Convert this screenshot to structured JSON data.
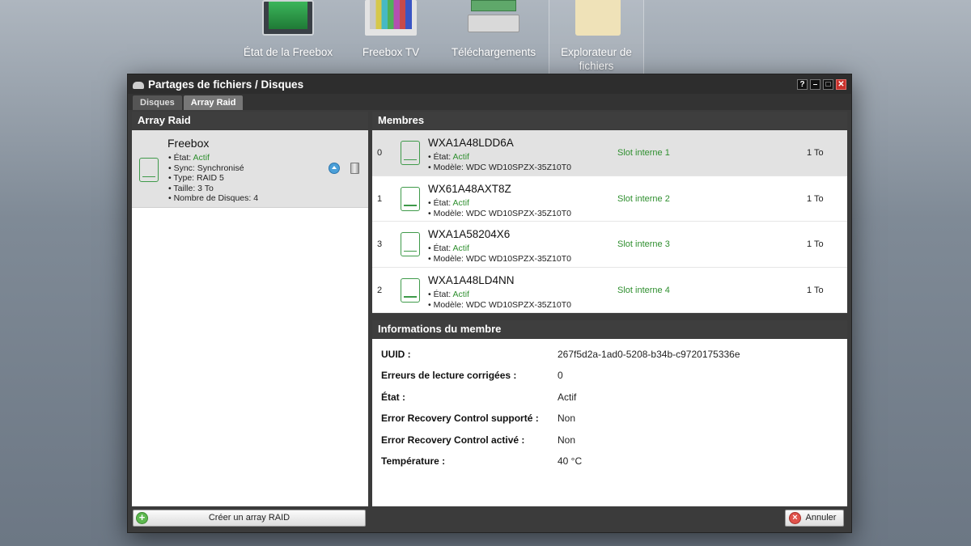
{
  "desktop": {
    "icons": [
      {
        "label": "État de la Freebox",
        "icon": "monitor-graph-icon"
      },
      {
        "label": "Freebox TV",
        "icon": "tv-icon"
      },
      {
        "label": "Téléchargements",
        "icon": "download-icon"
      },
      {
        "label": "Explorateur de fichiers",
        "icon": "folder-icon"
      }
    ]
  },
  "window": {
    "title": "Partages de fichiers / Disques",
    "buttons": {
      "help": "?",
      "minimize": "–",
      "maximize": "□",
      "close": "✕"
    },
    "tabs": [
      {
        "label": "Disques",
        "active": false
      },
      {
        "label": "Array Raid",
        "active": true
      }
    ]
  },
  "left_panel": {
    "title": "Array Raid",
    "array": {
      "name": "Freebox",
      "etat_label": "• État: ",
      "etat_value": "Actif",
      "sync": "• Sync: Synchronisé",
      "type": "• Type: RAID 5",
      "taille": "• Taille: 3 To",
      "nb_disques": "• Nombre de Disques: 4"
    },
    "create_button": "Créer un array RAID"
  },
  "members_panel": {
    "title": "Membres",
    "rows": [
      {
        "index": "0",
        "serial": "WXA1A48LDD6A",
        "etat_label": "• État: ",
        "etat_value": "Actif",
        "modele": "• Modèle: WDC WD10SPZX-35Z10T0",
        "slot": "Slot interne 1",
        "size": "1 To",
        "selected": true
      },
      {
        "index": "1",
        "serial": "WX61A48AXT8Z",
        "etat_label": "• État: ",
        "etat_value": "Actif",
        "modele": "• Modèle: WDC WD10SPZX-35Z10T0",
        "slot": "Slot interne 2",
        "size": "1 To",
        "selected": false
      },
      {
        "index": "3",
        "serial": "WXA1A58204X6",
        "etat_label": "• État: ",
        "etat_value": "Actif",
        "modele": "• Modèle: WDC WD10SPZX-35Z10T0",
        "slot": "Slot interne 3",
        "size": "1 To",
        "selected": false
      },
      {
        "index": "2",
        "serial": "WXA1A48LD4NN",
        "etat_label": "• État: ",
        "etat_value": "Actif",
        "modele": "• Modèle: WDC WD10SPZX-35Z10T0",
        "slot": "Slot interne 4",
        "size": "1 To",
        "selected": false
      }
    ]
  },
  "info_panel": {
    "title": "Informations du membre",
    "rows": [
      {
        "key": "UUID :",
        "value": "267f5d2a-1ad0-5208-b34b-c9720175336e"
      },
      {
        "key": "Erreurs de lecture corrigées :",
        "value": "0"
      },
      {
        "key": "État :",
        "value": "Actif"
      },
      {
        "key": "Error Recovery Control supporté :",
        "value": "Non"
      },
      {
        "key": "Error Recovery Control activé :",
        "value": "Non"
      },
      {
        "key": "Température :",
        "value": "40 °C"
      }
    ]
  },
  "footer": {
    "cancel_button": "Annuler"
  },
  "colors": {
    "accent_green": "#2f8f2f",
    "window_bg": "#3b3b3b",
    "close_red": "#c8302b"
  }
}
